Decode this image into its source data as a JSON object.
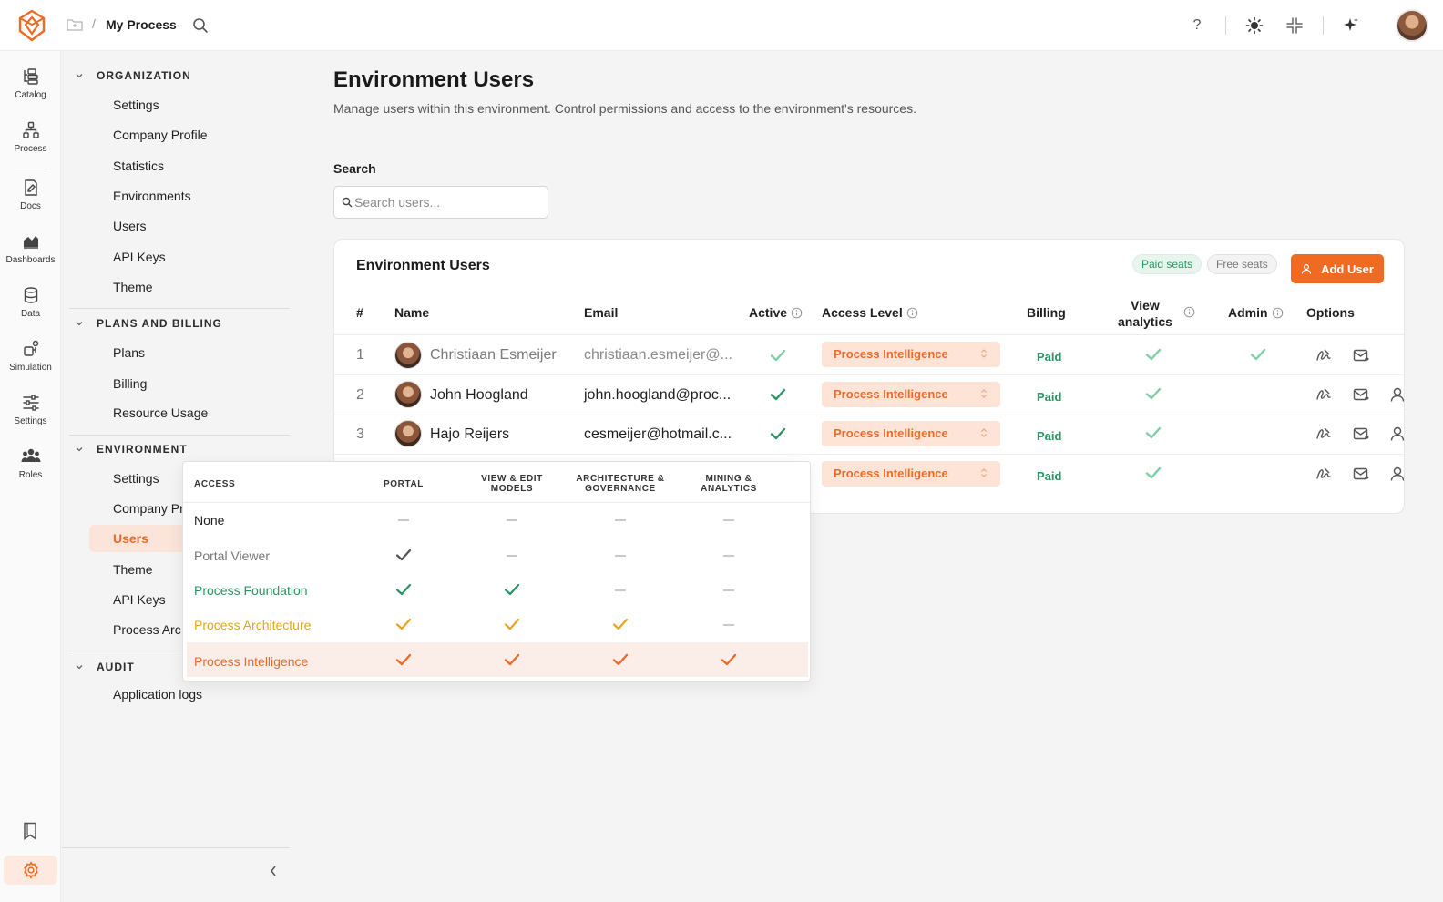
{
  "topbar": {
    "breadcrumb_sep": "/",
    "process_title": "My Process",
    "help_label": "?"
  },
  "rail": {
    "items": [
      {
        "label": "Catalog",
        "icon": "catalog-icon"
      },
      {
        "label": "Process",
        "icon": "process-icon"
      },
      {
        "label": "Docs",
        "icon": "docs-icon"
      },
      {
        "label": "Dashboards",
        "icon": "dashboards-icon"
      },
      {
        "label": "Data",
        "icon": "data-icon"
      },
      {
        "label": "Simulation",
        "icon": "simulation-icon"
      },
      {
        "label": "Settings",
        "icon": "settings-sliders-icon"
      },
      {
        "label": "Roles",
        "icon": "roles-icon"
      }
    ]
  },
  "sidebar": {
    "sections": [
      {
        "title": "ORGANIZATION",
        "items": [
          "Settings",
          "Company Profile",
          "Statistics",
          "Environments",
          "Users",
          "API Keys",
          "Theme"
        ]
      },
      {
        "title": "PLANS AND BILLING",
        "items": [
          "Plans",
          "Billing",
          "Resource Usage"
        ]
      },
      {
        "title": "ENVIRONMENT",
        "items": [
          "Settings",
          "Company Pr",
          "Users",
          "Theme",
          "API Keys",
          "Process Arc"
        ]
      },
      {
        "title": "AUDIT",
        "items": [
          "Application logs"
        ]
      }
    ]
  },
  "main": {
    "title": "Environment Users",
    "subtitle": "Manage users within this environment. Control permissions and access to the environment's resources.",
    "search_label": "Search",
    "search_placeholder": "Search users..."
  },
  "card": {
    "title": "Environment Users",
    "paid_seats": "Paid seats",
    "free_seats": "Free seats",
    "add_user": "Add User",
    "columns": {
      "num": "#",
      "name": "Name",
      "email": "Email",
      "active": "Active",
      "access": "Access Level",
      "billing": "Billing",
      "view_analytics_1": "View",
      "view_analytics_2": "analytics",
      "admin": "Admin",
      "options": "Options"
    },
    "rows": [
      {
        "num": "1",
        "name": "Christiaan Esmeijer",
        "email": "christiaan.esmeijer@...",
        "access": "Process Intelligence",
        "billing": "Paid",
        "active": true,
        "analytics": true,
        "admin": true
      },
      {
        "num": "2",
        "name": "John Hoogland",
        "email": "john.hoogland@proc...",
        "access": "Process Intelligence",
        "billing": "Paid",
        "active": true,
        "analytics": true,
        "admin": false
      },
      {
        "num": "3",
        "name": "Hajo Reijers",
        "email": "cesmeijer@hotmail.c...",
        "access": "Process Intelligence",
        "billing": "Paid",
        "active": true,
        "analytics": true,
        "admin": false
      },
      {
        "num": "",
        "name": "",
        "email": "",
        "access": "Process Intelligence",
        "billing": "Paid",
        "active": false,
        "analytics": true,
        "admin": false
      }
    ]
  },
  "popup": {
    "headers": {
      "access": "ACCESS",
      "portal": "PORTAL",
      "view_edit_1": "VIEW & EDIT",
      "view_edit_2": "MODELS",
      "arch_1": "ARCHITECTURE &",
      "arch_2": "GOVERNANCE",
      "mining_1": "MINING &",
      "mining_2": "ANALYTICS"
    },
    "rows": [
      {
        "label": "None",
        "color": "#1f1f1f",
        "perms": [
          false,
          false,
          false,
          false
        ]
      },
      {
        "label": "Portal Viewer",
        "color": "#777777",
        "perms": [
          true,
          false,
          false,
          false
        ]
      },
      {
        "label": "Process Foundation",
        "color": "#2a9462",
        "perms": [
          true,
          true,
          false,
          false
        ]
      },
      {
        "label": "Process Architecture",
        "color": "#e8a321",
        "perms": [
          true,
          true,
          true,
          false
        ]
      },
      {
        "label": "Process Intelligence",
        "color": "#ea6b29",
        "perms": [
          true,
          true,
          true,
          true
        ]
      }
    ]
  },
  "colors": {
    "accent": "#f06a22",
    "green": "#2a9462",
    "light_green": "#7fcfa6"
  }
}
